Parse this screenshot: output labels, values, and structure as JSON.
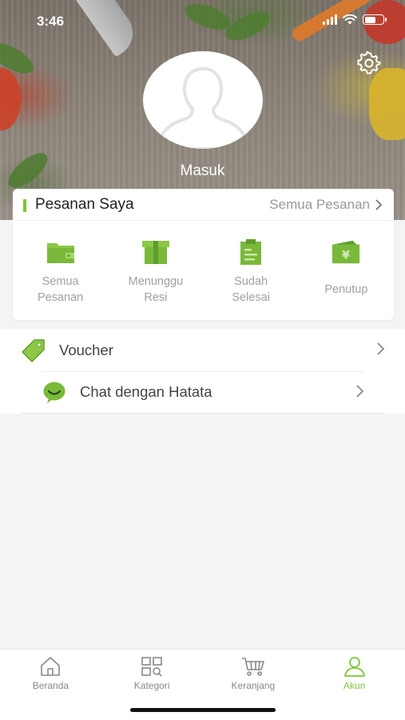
{
  "status_bar": {
    "time": "3:46"
  },
  "profile": {
    "login_label": "Masuk",
    "avatar_icon": "user-placeholder-icon",
    "settings_icon": "gear-icon"
  },
  "orders": {
    "title": "Pesanan Saya",
    "all_orders_link": "Semua Pesanan",
    "items": [
      {
        "label": "Semua\nPesanan",
        "icon": "wallet-icon"
      },
      {
        "label": "Menunggu\nResi",
        "icon": "box-icon"
      },
      {
        "label": "Sudah\nSelesai",
        "icon": "clipboard-icon"
      },
      {
        "label": "Penutup",
        "icon": "yen-card-icon"
      }
    ]
  },
  "menu": [
    {
      "label": "Voucher",
      "icon": "voucher-tag-icon"
    },
    {
      "label": "Chat dengan Hatata",
      "icon": "chat-smile-icon"
    }
  ],
  "tabbar": {
    "tabs": [
      {
        "label": "Beranda",
        "icon": "home-icon",
        "active": false
      },
      {
        "label": "Kategori",
        "icon": "category-grid-icon",
        "active": false
      },
      {
        "label": "Keranjang",
        "icon": "cart-icon",
        "active": false
      },
      {
        "label": "Akun",
        "icon": "account-icon",
        "active": true
      }
    ]
  },
  "colors": {
    "accent": "#7cc63a",
    "accent_dark": "#5e9e2a",
    "background": "#f4f4f4"
  }
}
